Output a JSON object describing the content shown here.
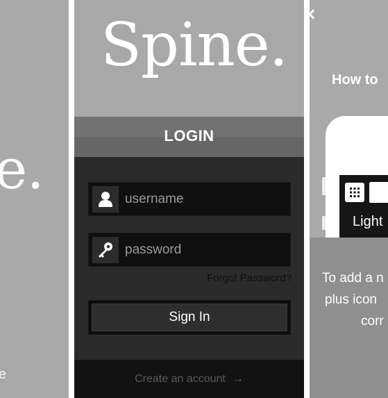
{
  "left_panel": {
    "logo_fragment": "e.",
    "text_fragment": "e"
  },
  "app": {
    "logo": "Spine."
  },
  "login": {
    "title": "LOGIN",
    "username_placeholder": "username",
    "password_placeholder": "password",
    "forgot_label": "Forgot Password?",
    "signin_label": "Sign In",
    "create_account_label": "Create an account",
    "create_account_arrow": "→"
  },
  "right_panel": {
    "close_glyph": "×",
    "heading": "How to",
    "light_text": "Light",
    "desc_line1": "To add a n",
    "desc_line2": "plus icon",
    "desc_line3": "corr"
  },
  "icons": {
    "username": "user-icon",
    "password": "key-icon",
    "grid": "grid-icon",
    "close": "close-icon",
    "arrow": "arrow-right-icon"
  },
  "colors": {
    "panel_gray": "#a9a9a9",
    "form_dark": "#2b2b2b",
    "field_bg": "#0f0f0f",
    "footer_bg": "#121212",
    "text_white": "#ffffff"
  }
}
